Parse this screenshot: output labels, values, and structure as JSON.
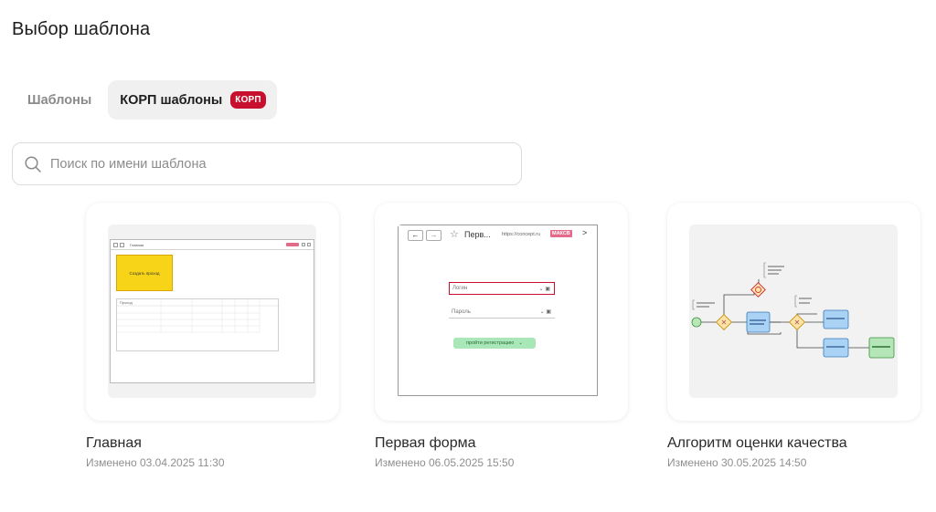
{
  "page": {
    "title": "Выбор шаблона"
  },
  "tabs": [
    {
      "label": "Шаблоны",
      "active": false
    },
    {
      "label": "КОРП шаблоны",
      "active": true,
      "badge": "КОРП"
    }
  ],
  "search": {
    "placeholder": "Поиск по имени шаблона",
    "value": ""
  },
  "templates": [
    {
      "name": "Главная",
      "modified": "Изменено 03.04.2025 11:30",
      "preview": {
        "page_title": "Главная",
        "button_text": "Создать проход",
        "table_header": "Проход"
      }
    },
    {
      "name": "Первая форма",
      "modified": "Изменено 06.05.2025 15:50",
      "preview": {
        "title": "Перв...",
        "url": "https://concept.ru",
        "url_badge": "МАКСВ",
        "login": "Логин",
        "password": "Пароль",
        "button": "пройти регистрацию"
      }
    },
    {
      "name": "Алгоритм оценки качества",
      "modified": "Изменено 30.05.2025 14:50",
      "preview": {
        "type": "bpmn-diagram"
      }
    }
  ],
  "colors": {
    "badge": "#c8102e",
    "accent_yellow": "#f7d417",
    "diagram_task": "#a9d2f5",
    "diagram_end": "#b5e6b8"
  }
}
